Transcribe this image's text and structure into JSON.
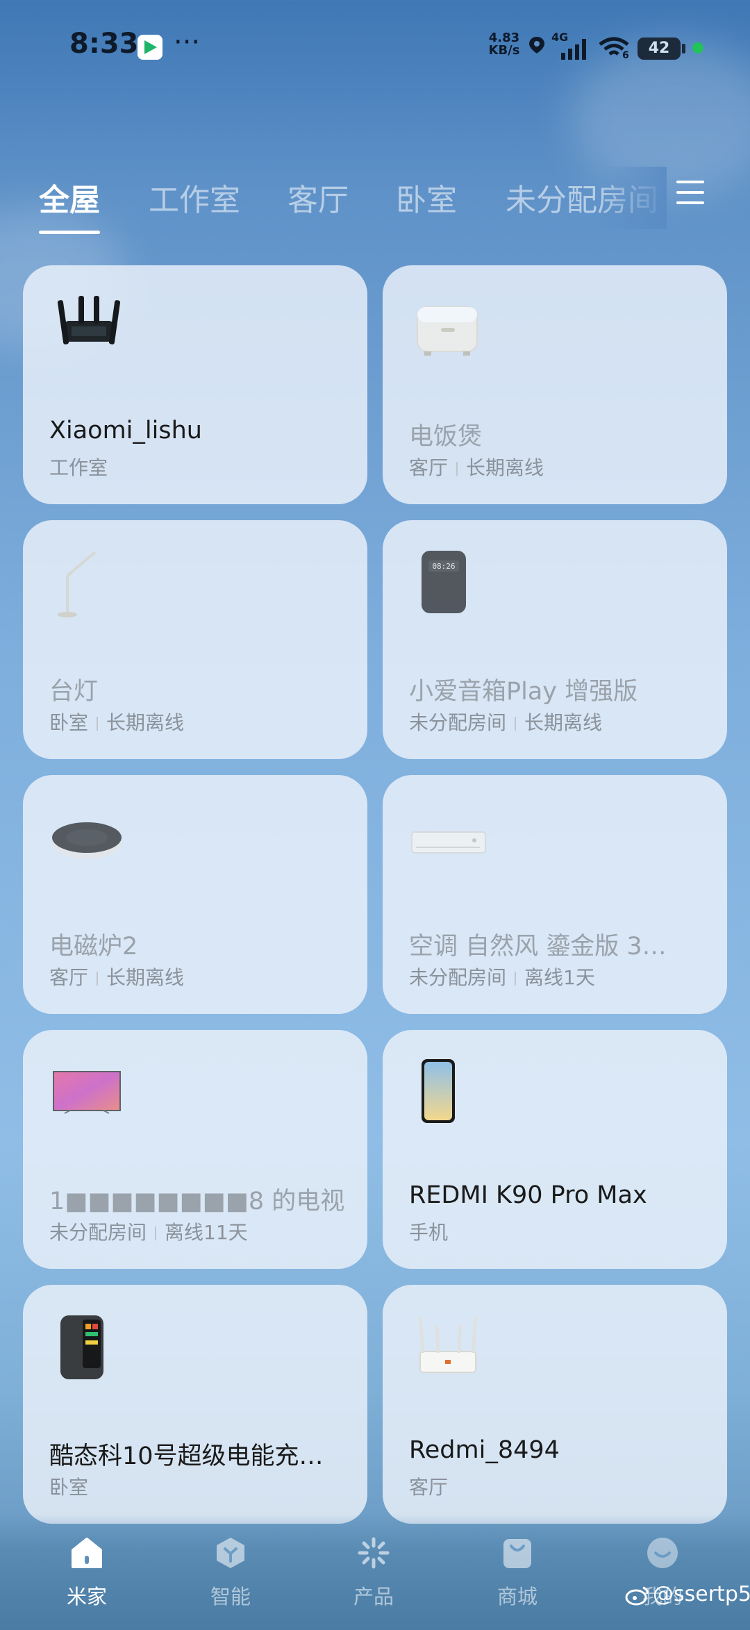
{
  "status_bar": {
    "time": "8:33",
    "app_icon": "play-store-icon",
    "more": "···",
    "speed_value": "4.83",
    "speed_unit": "KB/s",
    "network": "4G",
    "wifi_sub": "6",
    "battery": "42"
  },
  "tabs": [
    {
      "label": "全屋",
      "active": true
    },
    {
      "label": "工作室"
    },
    {
      "label": "客厅"
    },
    {
      "label": "卧室"
    },
    {
      "label": "未分配房间"
    }
  ],
  "devices": [
    {
      "name": "Xiaomi_lishu",
      "room": "工作室",
      "status": "",
      "icon": "router-icon"
    },
    {
      "name": "电饭煲",
      "room": "客厅",
      "status": "长期离线",
      "icon": "rice-cooker-icon"
    },
    {
      "name": "台灯",
      "room": "卧室",
      "status": "长期离线",
      "icon": "desk-lamp-icon"
    },
    {
      "name": "小爱音箱Play 增强版",
      "room": "未分配房间",
      "status": "长期离线",
      "icon": "smart-speaker-icon"
    },
    {
      "name": "电磁炉2",
      "room": "客厅",
      "status": "长期离线",
      "icon": "induction-cooker-icon"
    },
    {
      "name": "空调 自然风 鎏金版 3…",
      "room": "未分配房间",
      "status": "离线1天",
      "icon": "air-conditioner-icon"
    },
    {
      "name": "1■■■■■■■■8 的电视",
      "room": "未分配房间",
      "status": "离线11天",
      "icon": "tv-icon"
    },
    {
      "name": "REDMI K90 Pro Max",
      "room": "手机",
      "status": "",
      "icon": "phone-icon"
    },
    {
      "name": "酷态科10号超级电能充…",
      "room": "卧室",
      "status": "",
      "icon": "power-bank-icon"
    },
    {
      "name": "Redmi_8494",
      "room": "客厅",
      "status": "",
      "icon": "router-icon"
    }
  ],
  "bottom_nav": [
    {
      "label": "米家",
      "icon": "home-icon",
      "active": true
    },
    {
      "label": "智能",
      "icon": "smart-icon"
    },
    {
      "label": "产品",
      "icon": "product-icon"
    },
    {
      "label": "商城",
      "icon": "shop-icon"
    },
    {
      "label": "我的",
      "icon": "profile-icon"
    }
  ],
  "watermark": "@ssertp5"
}
